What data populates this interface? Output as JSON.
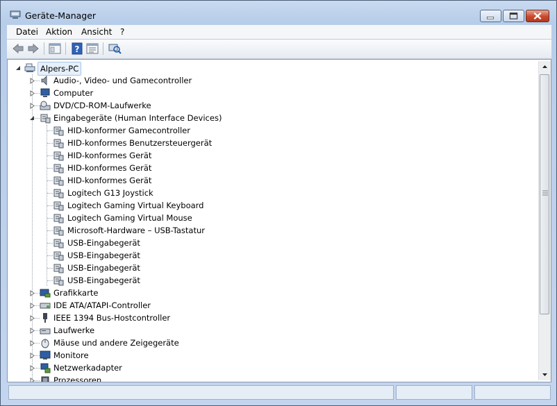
{
  "window": {
    "title": "Geräte-Manager"
  },
  "menu": [
    "Datei",
    "Aktion",
    "Ansicht",
    "?"
  ],
  "toolbar": {
    "buttons": [
      "back-icon",
      "forward-icon",
      "console-tree-icon",
      "help-icon",
      "properties-icon",
      "scan-hardware-icon"
    ]
  },
  "tree": {
    "root": "Alpers-PC",
    "categories": [
      "Audio-, Video- und Gamecontroller",
      "Computer",
      "DVD/CD-ROM-Laufwerke",
      "Eingabegeräte (Human Interface Devices)",
      "Grafikkarte",
      "IDE ATA/ATAPI-Controller",
      "IEEE 1394 Bus-Hostcontroller",
      "Laufwerke",
      "Mäuse und andere Zeigegeräte",
      "Monitore",
      "Netzwerkadapter",
      "Prozessoren"
    ],
    "hid_children": [
      "HID-konformer Gamecontroller",
      "HID-konformes Benutzersteuergerät",
      "HID-konformes Gerät",
      "HID-konformes Gerät",
      "HID-konformes Gerät",
      "Logitech G13 Joystick",
      "Logitech Gaming Virtual Keyboard",
      "Logitech Gaming Virtual Mouse",
      "Microsoft-Hardware – USB-Tastatur",
      "USB-Eingabegerät",
      "USB-Eingabegerät",
      "USB-Eingabegerät",
      "USB-Eingabegerät"
    ]
  },
  "colors": {
    "accent": "#3b6fb6",
    "selection": "#e6f0fb"
  }
}
